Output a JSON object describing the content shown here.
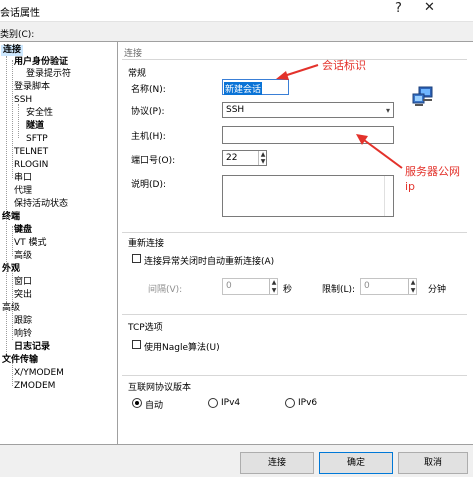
{
  "window": {
    "title": "会话属性",
    "help": "?",
    "close": "✕",
    "category_label": "类别(C):"
  },
  "tree": [
    {
      "label": "连接",
      "bold": true,
      "selected": true
    },
    {
      "label": "用户身份验证",
      "bold": true
    },
    {
      "label": "登录提示符"
    },
    {
      "label": "登录脚本"
    },
    {
      "label": "SSH"
    },
    {
      "label": "安全性"
    },
    {
      "label": "隧道",
      "bold": true
    },
    {
      "label": "SFTP"
    },
    {
      "label": "TELNET"
    },
    {
      "label": "RLOGIN"
    },
    {
      "label": "串口"
    },
    {
      "label": "代理"
    },
    {
      "label": "保持活动状态"
    },
    {
      "label": "终端",
      "bold": true
    },
    {
      "label": "键盘",
      "bold": true
    },
    {
      "label": "VT 模式"
    },
    {
      "label": "高级"
    },
    {
      "label": "外观",
      "bold": true
    },
    {
      "label": "窗口"
    },
    {
      "label": "突出"
    },
    {
      "label": "高级"
    },
    {
      "label": "跟踪"
    },
    {
      "label": "响铃"
    },
    {
      "label": "日志记录",
      "bold": true
    },
    {
      "label": "文件传输",
      "bold": true
    },
    {
      "label": "X/YMODEM"
    },
    {
      "label": "ZMODEM"
    }
  ],
  "panel": {
    "header": "连接",
    "general": {
      "title": "常规",
      "name_label": "名称(N):",
      "name_value": "新建会话",
      "protocol_label": "协议(P):",
      "protocol_value": "SSH",
      "host_label": "主机(H):",
      "host_value": "",
      "port_label": "端口号(O):",
      "port_value": "22",
      "desc_label": "说明(D):",
      "desc_value": ""
    },
    "reconnect": {
      "title": "重新连接",
      "checkbox_label": "连接异常关闭时自动重新连接(A)",
      "checked": false,
      "interval_label": "间隔(V):",
      "interval_value": "0",
      "interval_unit": "秒",
      "limit_label": "限制(L):",
      "limit_value": "0",
      "limit_unit": "分钟"
    },
    "tcp": {
      "title": "TCP选项",
      "checkbox_label": "使用Nagle算法(U)",
      "checked": false
    },
    "ip": {
      "title": "互联网协议版本",
      "options": [
        "自动",
        "IPv4",
        "IPv6"
      ],
      "selected": "自动"
    }
  },
  "annotations": {
    "session_id": "会话标识",
    "server_ip_line1": "服务器公网",
    "server_ip_line2": "ip",
    "color": "#e3322b"
  },
  "buttons": {
    "connect": "连接",
    "ok": "确定",
    "cancel": "取消"
  }
}
